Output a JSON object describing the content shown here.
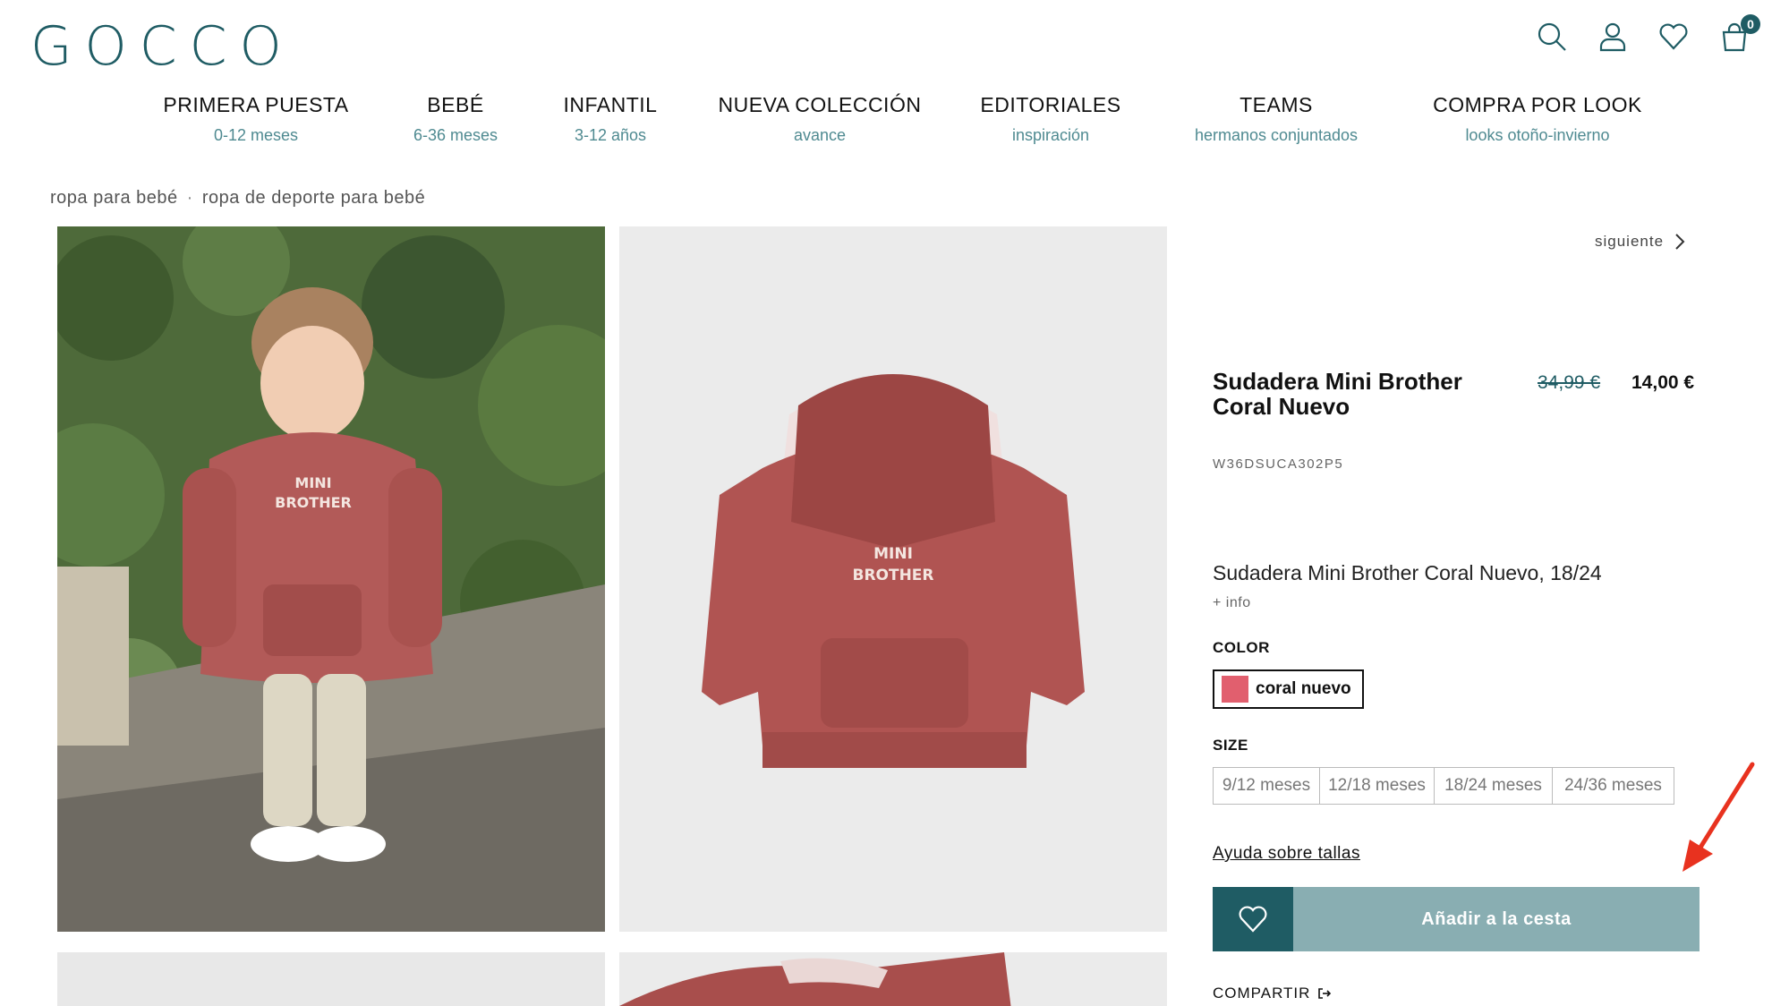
{
  "brand": {
    "logo": "GOCCO",
    "accent": "#1f5c64",
    "accent_light": "#89aeb2"
  },
  "header": {
    "icons": [
      "search-icon",
      "user-icon",
      "heart-icon",
      "bag-icon"
    ],
    "cart_count": "0"
  },
  "nav": [
    {
      "title": "PRIMERA PUESTA",
      "sub": "0-12 meses"
    },
    {
      "title": "BEBÉ",
      "sub": "6-36 meses"
    },
    {
      "title": "INFANTIL",
      "sub": "3-12 años"
    },
    {
      "title": "NUEVA COLECCIÓN",
      "sub": "avance"
    },
    {
      "title": "EDITORIALES",
      "sub": "inspiración"
    },
    {
      "title": "TEAMS",
      "sub": "hermanos conjuntados"
    },
    {
      "title": "COMPRA POR LOOK",
      "sub": "looks otoño-invierno"
    }
  ],
  "breadcrumb": [
    "ropa para bebé",
    "ropa de deporte para bebé"
  ],
  "breadcrumb_sep": "·",
  "gallery": {
    "print_line1": "MINI",
    "print_line2": "BROTHER"
  },
  "product": {
    "next_label": "siguiente",
    "title": "Sudadera Mini Brother Coral Nuevo",
    "price_old": "34,99 €",
    "price_new": "14,00 €",
    "sku": "W36DSUCA302P5",
    "description": "Sudadera Mini Brother Coral Nuevo, 18/24",
    "more_info": "+ info",
    "color_label": "COLOR",
    "color_name": "coral nuevo",
    "color_hex": "#e15f6e",
    "size_label": "SIZE",
    "sizes": [
      "9/12 meses",
      "12/18 meses",
      "18/24 meses",
      "24/36 meses"
    ],
    "size_help": "Ayuda sobre tallas",
    "add_to_cart": "Añadir a la cesta",
    "share": "COMPARTIR"
  }
}
